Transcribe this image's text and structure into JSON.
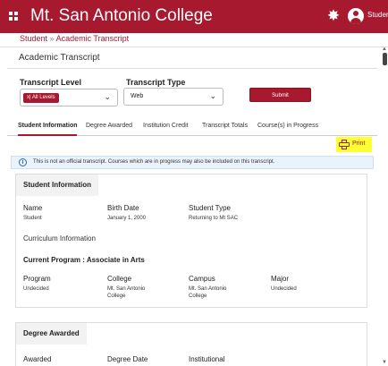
{
  "header": {
    "app_title": "Mt. San Antonio College",
    "user_label": "Student"
  },
  "breadcrumb": {
    "root": "Student",
    "separator": "»",
    "current": "Academic Transcript"
  },
  "page": {
    "title": "Academic Transcript"
  },
  "form": {
    "transcript_level_label": "Transcript Level",
    "transcript_level_tag": "x| All Levels",
    "transcript_type_label": "Transcript Type",
    "transcript_type_value": "Web",
    "submit_label": "Submit"
  },
  "tabs": [
    {
      "label": "Student Information",
      "active": true
    },
    {
      "label": "Degree Awarded",
      "active": false
    },
    {
      "label": "Institution Credit",
      "active": false
    },
    {
      "label": "Transcript Totals",
      "active": false
    },
    {
      "label": "Course(s) in Progress",
      "active": false
    }
  ],
  "print": {
    "label": "Print"
  },
  "notice": {
    "text": "This is not an official transcript. Courses which are in progress may also be included on this transcript."
  },
  "student_info": {
    "heading": "Student Information",
    "name_label": "Name",
    "name_value": "Student",
    "birth_date_label": "Birth Date",
    "birth_date_value": "January 1, 2000",
    "student_type_label": "Student Type",
    "student_type_value": "Returning to Mt SAC",
    "curriculum_heading": "Curriculum Information",
    "current_program": "Current Program : Associate in Arts",
    "program_label": "Program",
    "program_value": "Undecided",
    "college_label": "College",
    "college_value": "Mt. San Antonio College",
    "campus_label": "Campus",
    "campus_value": "Mt. San Antonio College",
    "major_label": "Major",
    "major_value": "Undecided"
  },
  "degree_awarded": {
    "heading": "Degree Awarded",
    "awarded_label": "Awarded",
    "degree_date_label": "Degree Date",
    "institutional_label": "Institutional"
  },
  "colors": {
    "brand": "#a6192e",
    "highlight": "#ffff33",
    "notice_bg": "#eaf2fa"
  }
}
